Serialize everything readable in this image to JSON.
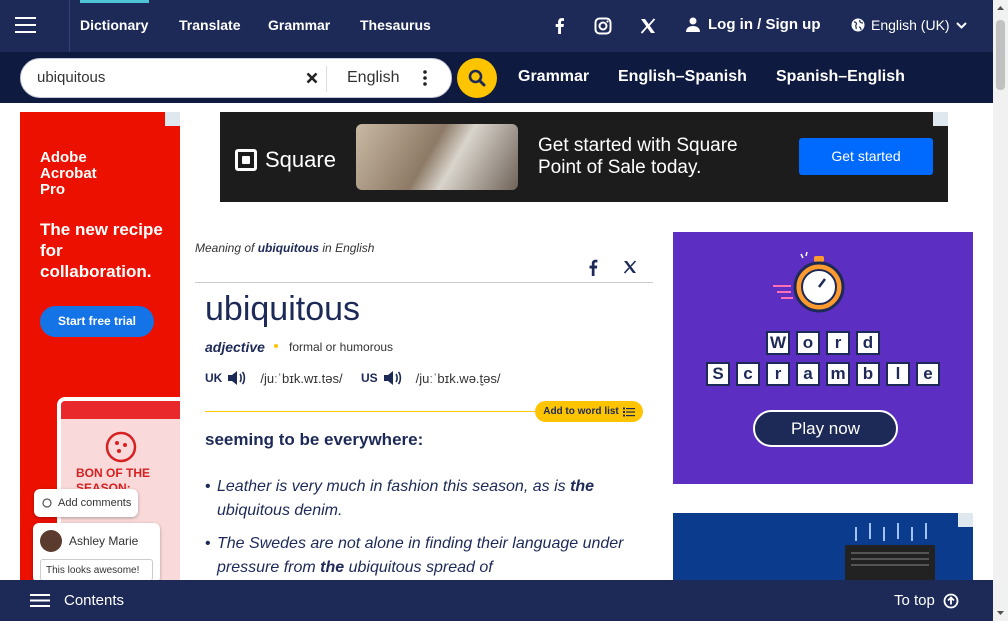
{
  "topnav": {
    "items": [
      "Dictionary",
      "Translate",
      "Grammar",
      "Thesaurus"
    ],
    "login": "Log in / Sign up",
    "language": "English (UK)"
  },
  "search": {
    "value": "ubiquitous",
    "dictionary": "English",
    "subnav": [
      "Grammar",
      "English–Spanish",
      "Spanish–English"
    ]
  },
  "ad_left": {
    "brand": "Adobe Acrobat Pro",
    "headline": "The new recipe for collaboration.",
    "cta": "Start free trial",
    "card_title": "BON OF THE SEASON: ...RPHIC",
    "comment_chip": "Add comments",
    "commenter": "Ashley Marie",
    "comment": "This looks awesome!"
  },
  "ad_top": {
    "brand": "Square",
    "headline": "Get started with Square Point of Sale today.",
    "cta": "Get started"
  },
  "entry": {
    "meaning_prefix": "Meaning of",
    "meaning_word": "ubiquitous",
    "meaning_suffix": "in English",
    "headword": "ubiquitous",
    "pos": "adjective",
    "usage": "formal or humorous",
    "uk_label": "UK",
    "uk_ipa": "/juːˈbɪk.wɪ.təs/",
    "us_label": "US",
    "us_ipa": "/juːˈbɪk.wə.t̬əs/",
    "add_to_list": "Add to word list",
    "definition": "seeming to be everywhere:",
    "example1_a": "Leather is very much in fashion this season, as is",
    "example1_b": "the",
    "example1_c": "ubiquitous denim.",
    "example2_a": "The Swedes are not alone in finding their language under pressure from",
    "example2_b": "the",
    "example2_c": "ubiquitous spread of"
  },
  "ad_right": {
    "row1": [
      "W",
      "o",
      "r",
      "d"
    ],
    "row2": [
      "S",
      "c",
      "r",
      "a",
      "m",
      "b",
      "l",
      "e"
    ],
    "cta": "Play now"
  },
  "bottombar": {
    "contents": "Contents",
    "to_top": "To top"
  },
  "colors": {
    "navy": "#1d2a57",
    "accent_yellow": "#fec400",
    "adobe_red": "#eb1000",
    "square_blue": "#006aff",
    "scramble_purple": "#5c2fc2"
  }
}
